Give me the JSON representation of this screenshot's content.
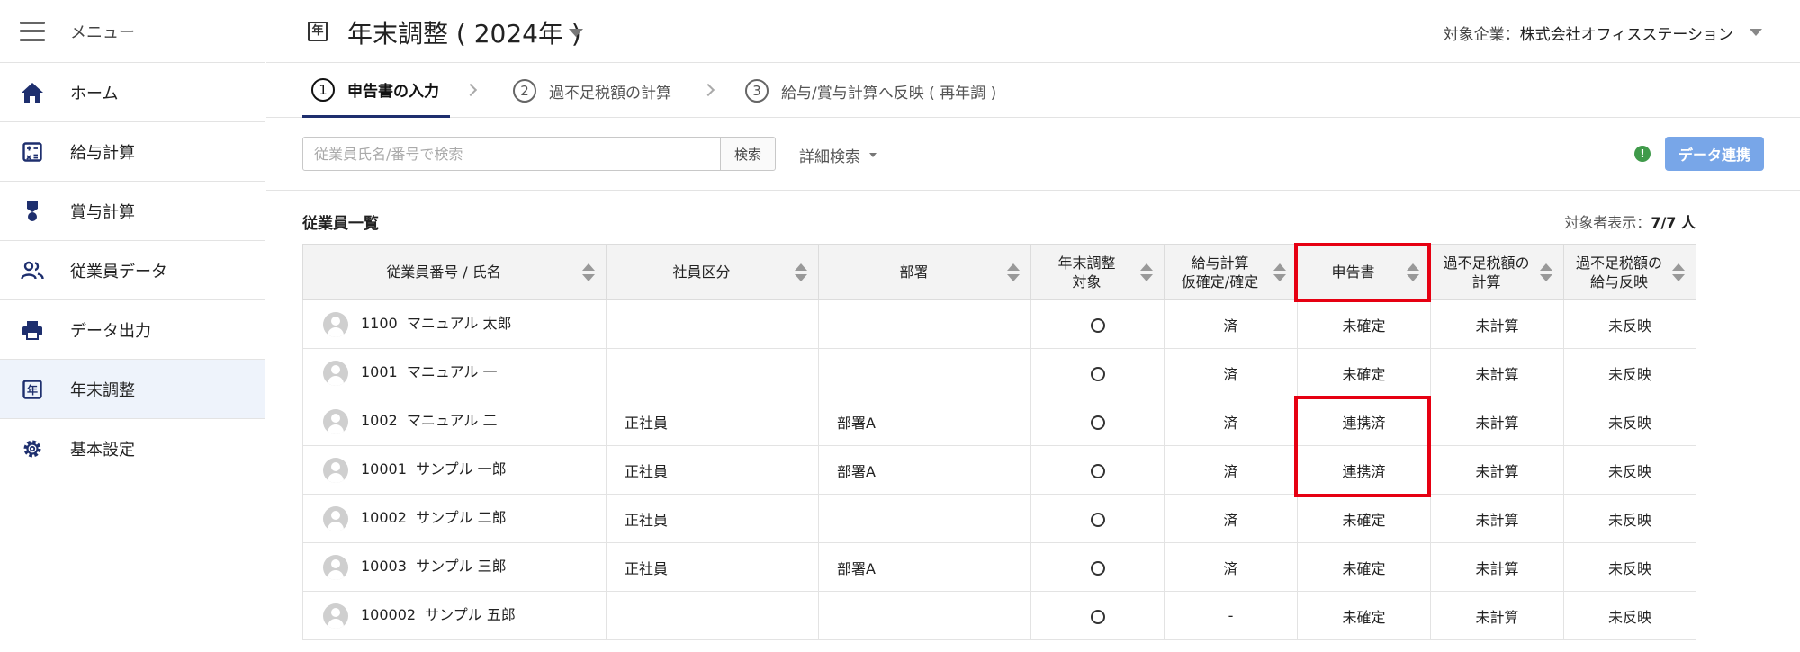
{
  "sidebar": {
    "menu_label": "メニュー",
    "items": [
      {
        "label": "ホーム",
        "icon": "home-icon"
      },
      {
        "label": "給与計算",
        "icon": "calculator-icon"
      },
      {
        "label": "賞与計算",
        "icon": "medal-icon"
      },
      {
        "label": "従業員データ",
        "icon": "users-icon"
      },
      {
        "label": "データ出力",
        "icon": "printer-icon"
      },
      {
        "label": "年末調整",
        "icon": "calendar-year-icon",
        "active": true
      },
      {
        "label": "基本設定",
        "icon": "gear-icon"
      }
    ]
  },
  "header": {
    "icon_text": "年",
    "title": "年末調整 ( 2024年 )",
    "company_label": "対象企業：",
    "company_name": "株式会社オフィスステーション"
  },
  "steps": [
    {
      "num": "1",
      "label": "申告書の入力",
      "active": true
    },
    {
      "num": "2",
      "label": "過不足税額の計算"
    },
    {
      "num": "3",
      "label": "給与/賞与計算へ反映 ( 再年調 )"
    }
  ],
  "search": {
    "placeholder": "従業員氏名/番号で検索",
    "button": "検索",
    "advanced": "詳細検索",
    "alert_icon_text": "!",
    "sync_button": "データ連携"
  },
  "list": {
    "title": "従業員一覧",
    "count_label": "対象者表示：",
    "count_value": "7/7 人"
  },
  "table": {
    "headers": [
      {
        "line1": "従業員番号 / 氏名",
        "line2": ""
      },
      {
        "line1": "社員区分",
        "line2": ""
      },
      {
        "line1": "部署",
        "line2": ""
      },
      {
        "line1": "年末調整",
        "line2": "対象"
      },
      {
        "line1": "給与計算",
        "line2": "仮確定/確定"
      },
      {
        "line1": "申告書",
        "line2": ""
      },
      {
        "line1": "過不足税額の",
        "line2": "計算"
      },
      {
        "line1": "過不足税額の",
        "line2": "給与反映"
      }
    ],
    "rows": [
      {
        "id": "1100",
        "name": "マニュアル 太郎",
        "category": "",
        "dept": "",
        "payroll": "済",
        "declaration": "未確定",
        "calc": "未計算",
        "reflect": "未反映"
      },
      {
        "id": "1001",
        "name": "マニュアル 一",
        "category": "",
        "dept": "",
        "payroll": "済",
        "declaration": "未確定",
        "calc": "未計算",
        "reflect": "未反映"
      },
      {
        "id": "1002",
        "name": "マニュアル 二",
        "category": "正社員",
        "dept": "部署A",
        "payroll": "済",
        "declaration": "連携済",
        "calc": "未計算",
        "reflect": "未反映"
      },
      {
        "id": "10001",
        "name": "サンプル 一郎",
        "category": "正社員",
        "dept": "部署A",
        "payroll": "済",
        "declaration": "連携済",
        "calc": "未計算",
        "reflect": "未反映"
      },
      {
        "id": "10002",
        "name": "サンプル 二郎",
        "category": "正社員",
        "dept": "",
        "payroll": "済",
        "declaration": "未確定",
        "calc": "未計算",
        "reflect": "未反映"
      },
      {
        "id": "10003",
        "name": "サンプル 三郎",
        "category": "正社員",
        "dept": "部署A",
        "payroll": "済",
        "declaration": "未確定",
        "calc": "未計算",
        "reflect": "未反映"
      },
      {
        "id": "100002",
        "name": "サンプル 五郎",
        "category": "",
        "dept": "",
        "payroll": "-",
        "declaration": "未確定",
        "calc": "未計算",
        "reflect": "未反映"
      }
    ]
  },
  "colors": {
    "accent_navy": "#1e2f6e",
    "link_blue": "#2a6fc9",
    "status_red": "#e00000",
    "highlight_red": "#e60012",
    "button_blue": "#78a6e8"
  }
}
